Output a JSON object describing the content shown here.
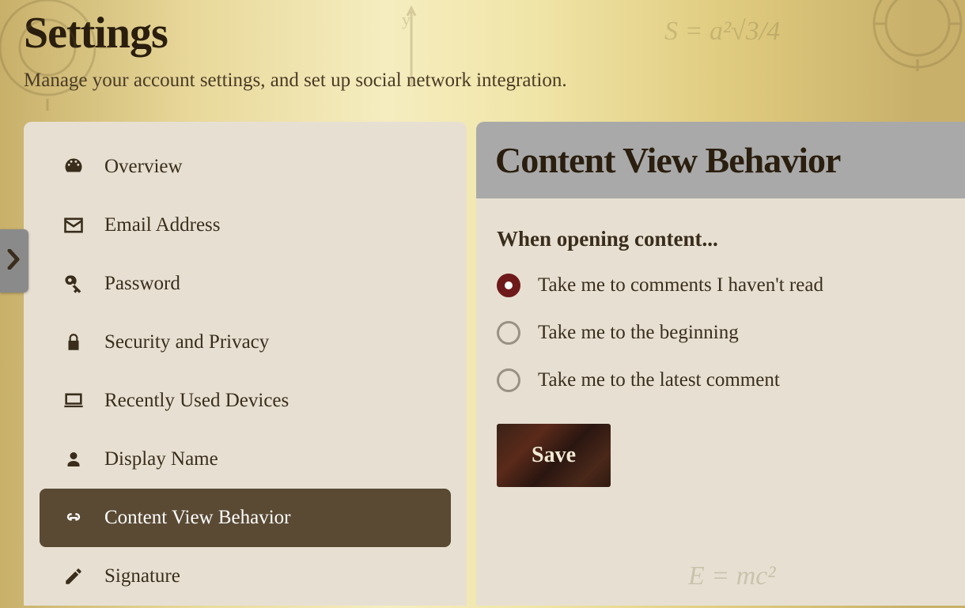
{
  "header": {
    "title": "Settings",
    "subtitle": "Manage your account settings, and set up social network integration."
  },
  "sidebar": {
    "items": [
      {
        "icon": "dashboard-icon",
        "label": "Overview",
        "active": false
      },
      {
        "icon": "envelope-icon",
        "label": "Email Address",
        "active": false
      },
      {
        "icon": "key-icon",
        "label": "Password",
        "active": false
      },
      {
        "icon": "lock-icon",
        "label": "Security and Privacy",
        "active": false
      },
      {
        "icon": "laptop-icon",
        "label": "Recently Used Devices",
        "active": false
      },
      {
        "icon": "user-icon",
        "label": "Display Name",
        "active": false
      },
      {
        "icon": "link-icon",
        "label": "Content View Behavior",
        "active": true
      },
      {
        "icon": "pencil-icon",
        "label": "Signature",
        "active": false
      }
    ]
  },
  "main": {
    "title": "Content View Behavior",
    "section_label": "When opening content...",
    "options": [
      {
        "label": "Take me to comments I haven't read",
        "checked": true
      },
      {
        "label": "Take me to the beginning",
        "checked": false
      },
      {
        "label": "Take me to the latest comment",
        "checked": false
      }
    ],
    "save_label": "Save"
  },
  "side_tab": {
    "icon": "chevron-right-icon"
  }
}
